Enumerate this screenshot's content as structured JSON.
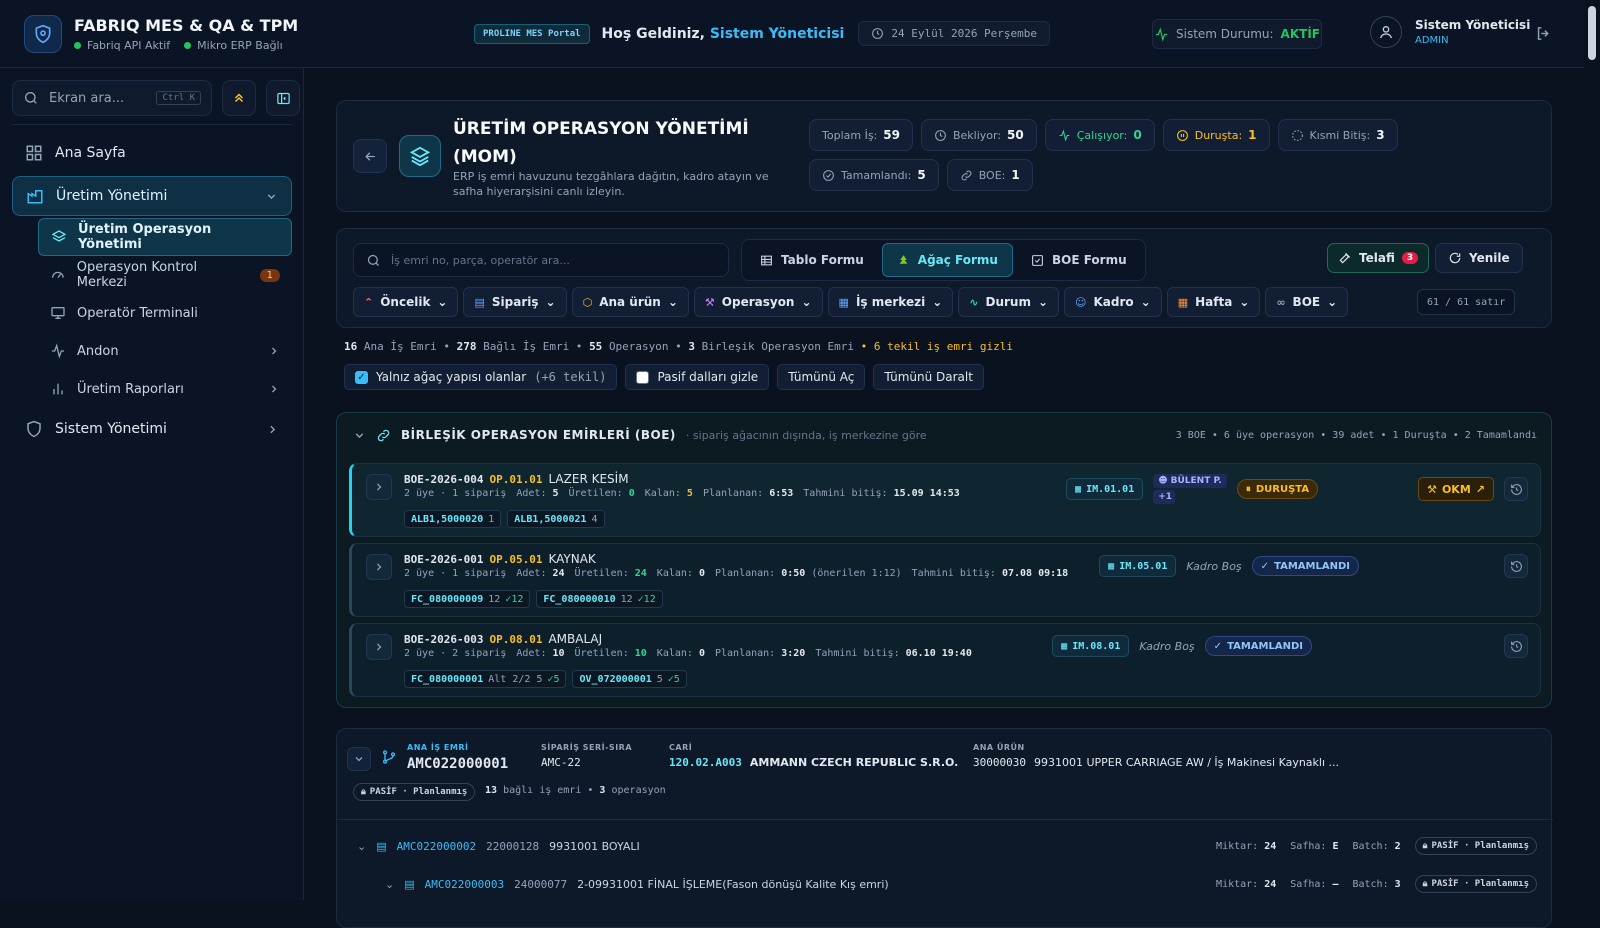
{
  "brand": {
    "title": "FABRIQ MES & QA & TPM",
    "status1": "Fabriq API Aktif",
    "status2": "Mikro ERP Bağlı"
  },
  "topbar": {
    "portal": "PROLINE MES Portal",
    "welcome": "Hoş Geldiniz,",
    "welcome_user": "Sistem Yöneticisi",
    "date": "24 Eylül 2026 Perşembe",
    "system_label": "Sistem Durumu:",
    "system_value": "AKTİF",
    "user_name": "Sistem Yöneticisi",
    "user_role": "ADMIN"
  },
  "sidebar": {
    "search_placeholder": "Ekran ara...",
    "search_shortcut": "Ctrl K",
    "items": [
      {
        "label": "Ana Sayfa"
      },
      {
        "label": "Üretim Yönetimi"
      },
      {
        "label": "Sistem Yönetimi"
      }
    ],
    "subitems": [
      {
        "label": "Üretim Operasyon Yönetimi"
      },
      {
        "label": "Operasyon Kontrol Merkezi",
        "badge": "1"
      },
      {
        "label": "Operatör Terminali"
      },
      {
        "label": "Andon"
      },
      {
        "label": "Üretim Raporları"
      }
    ]
  },
  "header": {
    "title": "ÜRETİM OPERASYON YÖNETİMİ (MOM)",
    "description": "ERP iş emri havuzunu tezgâhlara dağıtın, kadro atayın ve safha hiyerarşisini canlı izleyin.",
    "stats": [
      {
        "label": "Toplam İş:",
        "value": "59"
      },
      {
        "label": "Bekliyor:",
        "value": "50"
      },
      {
        "label": "Çalışıyor:",
        "value": "0"
      },
      {
        "label": "Duruşta:",
        "value": "1"
      },
      {
        "label": "Kısmi Bitiş:",
        "value": "3"
      },
      {
        "label": "Tamamlandı:",
        "value": "5"
      },
      {
        "label": "BOE:",
        "value": "1"
      }
    ]
  },
  "filters": {
    "search_placeholder": "İş emri no, parça, operatör ara...",
    "view_tabs": [
      "Tablo Formu",
      "Ağaç Formu",
      "BOE Formu"
    ],
    "telafi_label": "Telafi",
    "telafi_count": "3",
    "refresh_label": "Yenile",
    "chips": [
      "Öncelik",
      "Sipariş",
      "Ana ürün",
      "Operasyon",
      "İş merkezi",
      "Durum",
      "Kadro",
      "Hafta",
      "BOE"
    ],
    "row_count": "61 / 61 satır"
  },
  "summary": {
    "p1": "16",
    "t1": "Ana İş Emri •",
    "p2": "278",
    "t2": "Bağlı İş Emri •",
    "p3": "55",
    "t3": "Operasyon •",
    "p4": "3",
    "t4": "Birleşik Operasyon Emri",
    "warn": "• 6 tekil iş emri gizli"
  },
  "options": {
    "only_tree": "Yalnız ağaç yapısı olanlar",
    "only_tree_extra": "(+6 tekil)",
    "hide_passive": "Pasif dalları gizle",
    "expand_all": "Tümünü Aç",
    "collapse_all": "Tümünü Daralt"
  },
  "boe": {
    "title": "BİRLEŞİK OPERASYON EMİRLERİ (BOE)",
    "subtitle": "· sipariş ağacının dışında, iş merkezine göre",
    "meta": "3 BOE • 6 üye operasyon • 39 adet • 1 Duruşta • 2 Tamamlandı",
    "rows": [
      {
        "code": "BOE-2026-004",
        "op": "OP.01.01",
        "name": "LAZER KESİM",
        "members": "2 üye · 1 sipariş",
        "adet": "5",
        "uretilen": "0",
        "kalan": "5",
        "planlanan": "6:53",
        "onerilen": "",
        "bitis": "15.09 14:53",
        "tags": [
          {
            "code": "ALB1,5000020",
            "qty": "1",
            "done": ""
          },
          {
            "code": "ALB1,5000021",
            "qty": "4",
            "done": ""
          }
        ],
        "im": "IM.01.01",
        "user": "BÜLENT P.",
        "user_extra": "+1",
        "kadro": "",
        "status": "DURUŞTA",
        "okm": "OKM"
      },
      {
        "code": "BOE-2026-001",
        "op": "OP.05.01",
        "name": "KAYNAK",
        "members": "2 üye · 1 sipariş",
        "adet": "24",
        "uretilen": "24",
        "kalan": "0",
        "planlanan": "0:50",
        "onerilen": "(önerilen 1:12)",
        "bitis": "07.08 09:18",
        "tags": [
          {
            "code": "FC_080000009",
            "qty": "12",
            "done": "✓12"
          },
          {
            "code": "FC_080000010",
            "qty": "12",
            "done": "✓12"
          }
        ],
        "im": "IM.05.01",
        "user": "",
        "user_extra": "",
        "kadro": "Kadro Boş",
        "status": "TAMAMLANDI",
        "okm": ""
      },
      {
        "code": "BOE-2026-003",
        "op": "OP.08.01",
        "name": "AMBALAJ",
        "members": "2 üye · 2 sipariş",
        "adet": "10",
        "uretilen": "10",
        "kalan": "0",
        "planlanan": "3:20",
        "onerilen": "",
        "bitis": "06.10 19:40",
        "tags": [
          {
            "code": "FC_080000001",
            "qty": "Alt 2/2  5",
            "done": "✓5"
          },
          {
            "code": "OV_072000001",
            "qty": "5",
            "done": "✓5"
          }
        ],
        "im": "IM.08.01",
        "user": "",
        "user_extra": "",
        "kadro": "Kadro Boş",
        "status": "TAMAMLANDI",
        "okm": ""
      }
    ]
  },
  "order": {
    "ana_label": "ANA İŞ EMRİ",
    "ana_value": "AMC022000001",
    "siparis_label": "SİPARİŞ SERİ-SIRA",
    "siparis_value": "AMC-22",
    "cari_label": "CARİ",
    "cari_code": "120.02.A003",
    "cari_name": "AMMANN CZECH REPUBLIC S.R.O.",
    "urun_label": "ANA ÜRÜN",
    "urun_code": "30000030",
    "urun_name": "9931001 UPPER CARRIAGE AW / İş Makinesi Kaynaklı ...",
    "status": "PASİF · Planlanmış",
    "meta_n1": "13",
    "meta_t1": "bağlı iş emri •",
    "meta_n2": "3",
    "meta_t2": "operasyon",
    "subrows": [
      {
        "code": "AMC022000002",
        "num": "22000128",
        "name": "9931001 BOYALI",
        "miktar": "24",
        "safha": "E",
        "batch": "2",
        "status": "PASİF · Planlanmış"
      },
      {
        "code": "AMC022000003",
        "num": "24000077",
        "name": "2-09931001 FİNAL İŞLEME(Fason dönüşü Kalite Kış emri)",
        "miktar": "24",
        "safha": "–",
        "batch": "3",
        "status": "PASİF · Planlanmış"
      }
    ],
    "labels": {
      "miktar": "Miktar:",
      "safha": "Safha:",
      "batch": "Batch:"
    }
  },
  "colors": {
    "accent": "#38bdf8",
    "warning": "#fbbf24",
    "success": "#22c55e",
    "background": "#0a1220"
  }
}
